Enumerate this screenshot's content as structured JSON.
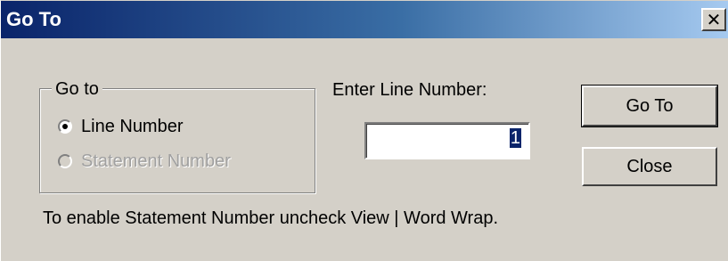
{
  "window": {
    "title": "Go To",
    "close_glyph": "✕"
  },
  "group": {
    "legend": "Go to",
    "options": [
      {
        "label": "Line Number",
        "checked": true,
        "enabled": true
      },
      {
        "label": "Statement Number",
        "checked": false,
        "enabled": false
      }
    ]
  },
  "input": {
    "label": "Enter Line Number:",
    "value": "1"
  },
  "buttons": {
    "goto_label": "Go To",
    "close_label": "Close"
  },
  "hint": "To enable Statement Number uncheck View | Word Wrap.",
  "colors": {
    "title_gradient_start": "#0a246a",
    "title_gradient_end": "#a6caf0",
    "face": "#d4d0c8",
    "selection": "#0a246a"
  },
  "icons": {
    "close": "close-icon"
  }
}
